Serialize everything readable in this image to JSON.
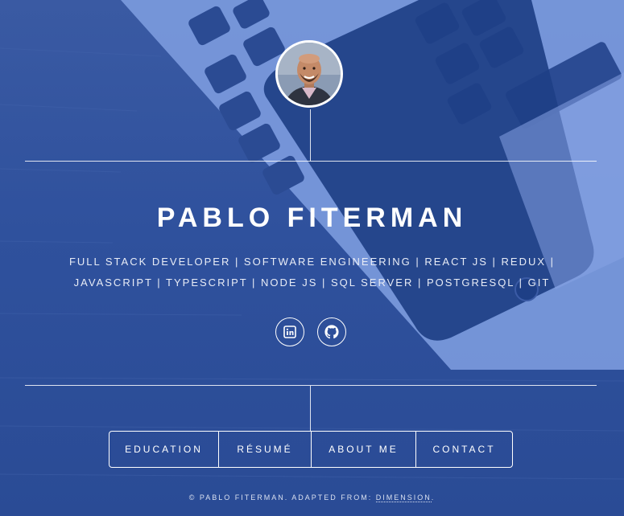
{
  "header": {
    "name": "PABLO FITERMAN",
    "skills_line1": "FULL STACK DEVELOPER | SOFTWARE ENGINEERING | REACT JS | REDUX |",
    "skills_line2": "JAVASCRIPT | TYPESCRIPT | NODE JS | SQL SERVER | POSTGRESQL | GIT"
  },
  "avatar": {
    "icon": "profile-photo"
  },
  "social": [
    {
      "icon": "linkedin-icon"
    },
    {
      "icon": "github-icon"
    }
  ],
  "nav": {
    "education": "EDUCATION",
    "resume": "RÉSUMÉ",
    "about": "ABOUT ME",
    "contact": "CONTACT"
  },
  "footer": {
    "prefix": "© PABLO FITERMAN. ADAPTED FROM: ",
    "link": "DIMENSION",
    "suffix": "."
  },
  "colors": {
    "overlay": "#2d4f99",
    "text": "#ffffff"
  }
}
